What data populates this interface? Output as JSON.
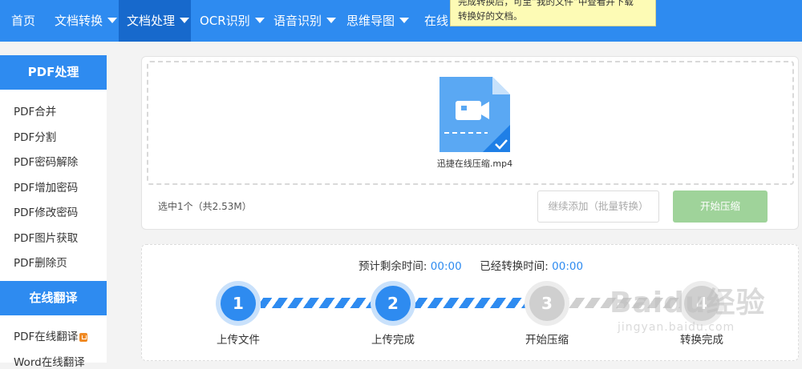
{
  "nav": {
    "items": [
      {
        "label": "首页",
        "caret": false
      },
      {
        "label": "文档转换",
        "caret": true
      },
      {
        "label": "文档处理",
        "caret": true,
        "active": true
      },
      {
        "label": "OCR识别",
        "caret": true
      },
      {
        "label": "语音识别",
        "caret": true
      },
      {
        "label": "思维导图",
        "caret": true
      },
      {
        "label": "在线",
        "caret": false
      }
    ]
  },
  "tooltip": {
    "line1": "完成转换后，可至“我的文件”中查看并下载",
    "line2": "转换好的文档。"
  },
  "sidebar": {
    "pdf_section": "PDF处理",
    "pdf_items": [
      "PDF合并",
      "PDF分割",
      "PDF密码解除",
      "PDF增加密码",
      "PDF修改密码",
      "PDF图片获取",
      "PDF删除页"
    ],
    "translate_section": "在线翻译",
    "translate_items": [
      "PDF在线翻译",
      "Word在线翻译"
    ]
  },
  "upload": {
    "file_name": "迅捷在线压缩.mp4",
    "selection_info": "选中1个（共2.53M）",
    "continue_label": "继续添加（批量转换）",
    "start_label": "开始压缩"
  },
  "progress": {
    "remaining_label": "预计剩余时间:",
    "remaining_value": "00:00",
    "elapsed_label": "已经转换时间:",
    "elapsed_value": "00:00",
    "steps": [
      {
        "num": "1",
        "label": "上传文件",
        "state": "done"
      },
      {
        "num": "2",
        "label": "上传完成",
        "state": "done"
      },
      {
        "num": "3",
        "label": "开始压缩",
        "state": "todo"
      },
      {
        "num": "4",
        "label": "转换完成",
        "state": "todo"
      }
    ]
  },
  "watermark": {
    "brand": "Baidu经验",
    "site": "jingyan.baidu.com"
  },
  "colors": {
    "primary": "#2e8bf0",
    "nav_active": "#1769cc",
    "start_button": "#9fd39a",
    "tooltip_bg": "#fdfbb5"
  }
}
